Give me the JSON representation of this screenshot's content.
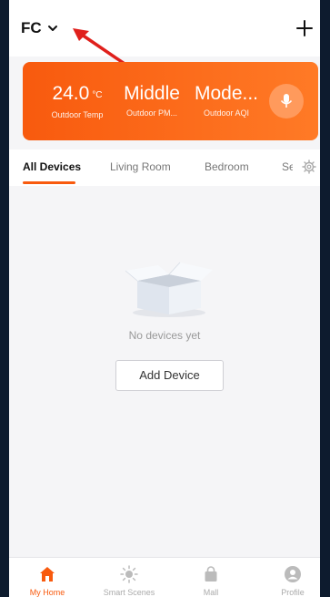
{
  "header": {
    "home_name": "FC"
  },
  "weather": [
    {
      "value": "24.0",
      "unit": "°C",
      "label": "Outdoor Temp"
    },
    {
      "value": "Middle",
      "unit": "",
      "label": "Outdoor PM..."
    },
    {
      "value": "Mode...",
      "unit": "",
      "label": "Outdoor AQI"
    }
  ],
  "tabs": [
    {
      "label": "All Devices",
      "active": true
    },
    {
      "label": "Living Room",
      "active": false
    },
    {
      "label": "Bedroom",
      "active": false
    },
    {
      "label": "Se",
      "active": false
    }
  ],
  "empty_state": {
    "message": "No devices yet",
    "button_label": "Add Device"
  },
  "bottom_nav": [
    {
      "label": "My Home",
      "icon": "home-icon",
      "active": true
    },
    {
      "label": "Smart Scenes",
      "icon": "sun-icon",
      "active": false
    },
    {
      "label": "Mall",
      "icon": "shopping-bag-icon",
      "active": false
    },
    {
      "label": "Profile",
      "icon": "profile-icon",
      "active": false
    }
  ],
  "colors": {
    "accent": "#f85a0e",
    "annotation_arrow": "#e0201c",
    "background": "#f5f5f7"
  }
}
